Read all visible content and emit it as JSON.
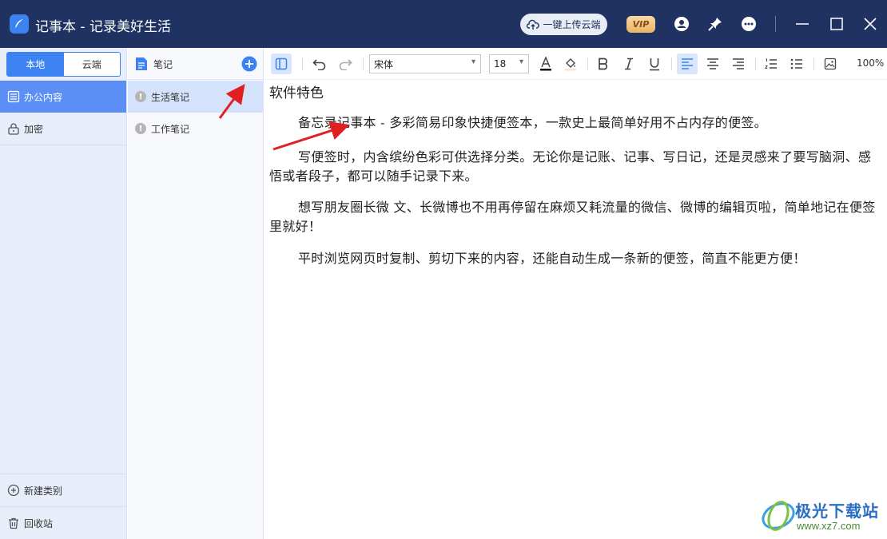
{
  "window": {
    "title": "记事本 - 记录美好生活",
    "upload_label": "一键上传云端",
    "vip_label": "VIP"
  },
  "sidebar": {
    "tabs": [
      {
        "label": "本地",
        "active": true
      },
      {
        "label": "云端",
        "active": false
      }
    ],
    "categories": [
      {
        "label": "办公内容",
        "selected": true
      },
      {
        "label": "加密",
        "selected": false
      }
    ],
    "new_category_label": "新建类别",
    "trash_label": "回收站"
  },
  "notes": {
    "header_label": "笔记",
    "items": [
      {
        "label": "生活笔记",
        "selected": true
      },
      {
        "label": "工作笔记",
        "selected": false
      }
    ]
  },
  "toolbar": {
    "font_family": "宋体",
    "font_size": "18",
    "zoom": "100%"
  },
  "document": {
    "title": "软件特色",
    "paragraphs": [
      "备忘录记事本 - 多彩简易印象快捷便签本，一款史上最简单好用不占内存的便签。",
      "写便签时，内含缤纷色彩可供选择分类。无论你是记账、记事、写日记，还是灵感来了要写脑洞、感悟或者段子，都可以随手记录下来。",
      "想写朋友圈长微 文、长微博也不用再停留在麻烦又耗流量的微信、微博的编辑页啦，简单地记在便签里就好！",
      "平时浏览网页时复制、剪切下来的内容，还能自动生成一条新的便签，简直不能更方便！"
    ]
  },
  "watermark": {
    "name": "极光下载站",
    "url": "www.xz7.com"
  },
  "colors": {
    "titlebar": "#1f3262",
    "accent": "#3c82f0",
    "selected_category": "#5b8ff5",
    "selected_note": "#d4e2fb",
    "arrow": "#e02020"
  }
}
